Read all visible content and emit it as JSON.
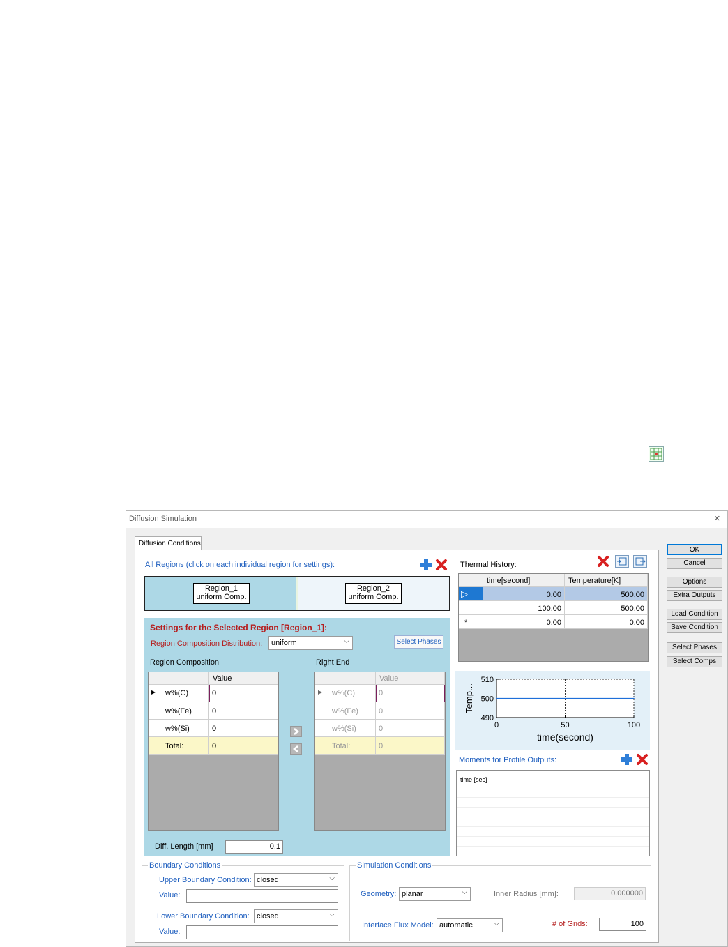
{
  "window": {
    "title": "Diffusion Simulation",
    "close": "×"
  },
  "tab": {
    "label": "Diffusion Conditions"
  },
  "regions": {
    "header": "All Regions (click on each individual region for settings):",
    "items": [
      {
        "line1": "Region_1",
        "line2": "uniform Comp."
      },
      {
        "line1": "Region_2",
        "line2": "uniform Comp."
      }
    ]
  },
  "settings": {
    "title": "Settings for the Selected Region [Region_1]:",
    "dist_label": "Region Composition Distribution:",
    "dist_value": "uniform",
    "select_phases": "Select Phases",
    "comp_label": "Region Composition",
    "right_end_label": "Right End",
    "value_header": "Value",
    "rows": [
      {
        "name": "w%(C)",
        "value": "0"
      },
      {
        "name": "w%(Fe)",
        "value": "0"
      },
      {
        "name": "w%(Si)",
        "value": "0"
      },
      {
        "name": "Total:",
        "value": "0"
      }
    ],
    "diff_length_label": "Diff. Length [mm]",
    "diff_length_value": "0.1"
  },
  "thermal": {
    "label": "Thermal History:",
    "headers": [
      "time[second]",
      "Temperature[K]"
    ],
    "rows": [
      {
        "marker": "▷",
        "time": "0.00",
        "temp": "500.00"
      },
      {
        "marker": "",
        "time": "100.00",
        "temp": "500.00"
      },
      {
        "marker": "*",
        "time": "0.00",
        "temp": "0.00"
      }
    ]
  },
  "chart_data": {
    "type": "line",
    "x": [
      0,
      100
    ],
    "series": [
      {
        "values": [
          500,
          500
        ]
      }
    ],
    "xlabel": "time(second)",
    "ylabel": "Temp...",
    "xlim": [
      0,
      100
    ],
    "ylim": [
      490,
      510
    ],
    "xticks": [
      "0",
      "50",
      "100"
    ],
    "yticks": [
      "510",
      "500",
      "490"
    ],
    "color": "#1e6fd9"
  },
  "moments": {
    "label": "Moments for Profile Outputs:",
    "first_row": "time [sec]"
  },
  "boundary": {
    "title": "Boundary Conditions",
    "upper_label": "Upper Boundary Condition:",
    "upper_value": "closed",
    "lower_label": "Lower Boundary Condition:",
    "lower_value": "closed",
    "value_label": "Value:"
  },
  "simulation": {
    "title": "Simulation Conditions",
    "geometry_label": "Geometry:",
    "geometry_value": "planar",
    "inner_radius_label": "Inner Radius [mm]:",
    "inner_radius_value": "0.000000",
    "flux_label": "Interface Flux Model:",
    "flux_value": "automatic",
    "grids_label": "# of Grids:",
    "grids_value": "100"
  },
  "buttons": {
    "ok": "OK",
    "cancel": "Cancel",
    "options": "Options",
    "extra_outputs": "Extra Outputs",
    "load_condition": "Load Condition",
    "save_condition": "Save Condition",
    "select_phases": "Select Phases",
    "select_comps": "Select Comps"
  },
  "colors": {
    "region_selected": "#add8e6",
    "region_other": "#eef5fa",
    "accent_blue": "#1f5fbf",
    "accent_red": "#b51e1e"
  }
}
